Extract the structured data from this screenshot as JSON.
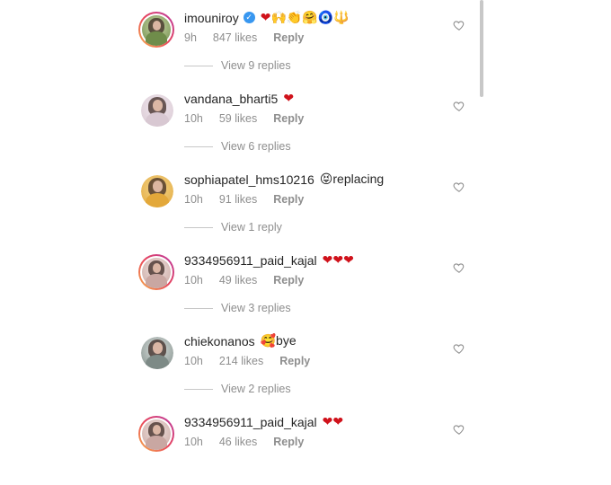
{
  "comments": [
    {
      "username": "imouniroy",
      "verified": true,
      "text": "❤️🙌👏🤗🧿🔱",
      "time": "9h",
      "likes": "847 likes",
      "reply": "Reply",
      "view": "View 9 replies",
      "avatar_colors": [
        "#6f8c4a",
        "#c9d6a6"
      ]
    },
    {
      "username": "vandana_bharti5",
      "verified": false,
      "text": "❤️",
      "time": "10h",
      "likes": "59 likes",
      "reply": "Reply",
      "view": "View 6 replies",
      "avatar_colors": [
        "#d8c8d2",
        "#f1e7ee"
      ]
    },
    {
      "username": "sophiapatel_hms10216",
      "verified": false,
      "text": "😝replacing",
      "time": "10h",
      "likes": "91 likes",
      "reply": "Reply",
      "view": "View 1 reply",
      "avatar_colors": [
        "#e3a83a",
        "#f3d58d"
      ]
    },
    {
      "username": "9334956911_paid_kajal",
      "verified": false,
      "text": "❤️❤️❤️",
      "time": "10h",
      "likes": "49 likes",
      "reply": "Reply",
      "view": "View 3 replies",
      "avatar_colors": [
        "#c9a7a2",
        "#efe1dd"
      ]
    },
    {
      "username": "chiekonanos",
      "verified": false,
      "text": "🥰bye",
      "time": "10h",
      "likes": "214 likes",
      "reply": "Reply",
      "view": "View 2 replies",
      "avatar_colors": [
        "#7d8a86",
        "#dfe4e2"
      ]
    },
    {
      "username": "9334956911_paid_kajal",
      "verified": false,
      "text": "❤️❤️",
      "time": "10h",
      "likes": "46 likes",
      "reply": "Reply",
      "view": "",
      "avatar_colors": [
        "#c9a7a2",
        "#efe1dd"
      ]
    }
  ],
  "colors": {
    "text_primary": "#262626",
    "text_secondary": "#8e8e8e",
    "verified_blue": "#3897f0",
    "heart_red": "#d0121b"
  },
  "icons": {
    "verified": "verified-badge-icon",
    "like": "heart-outline-icon"
  }
}
